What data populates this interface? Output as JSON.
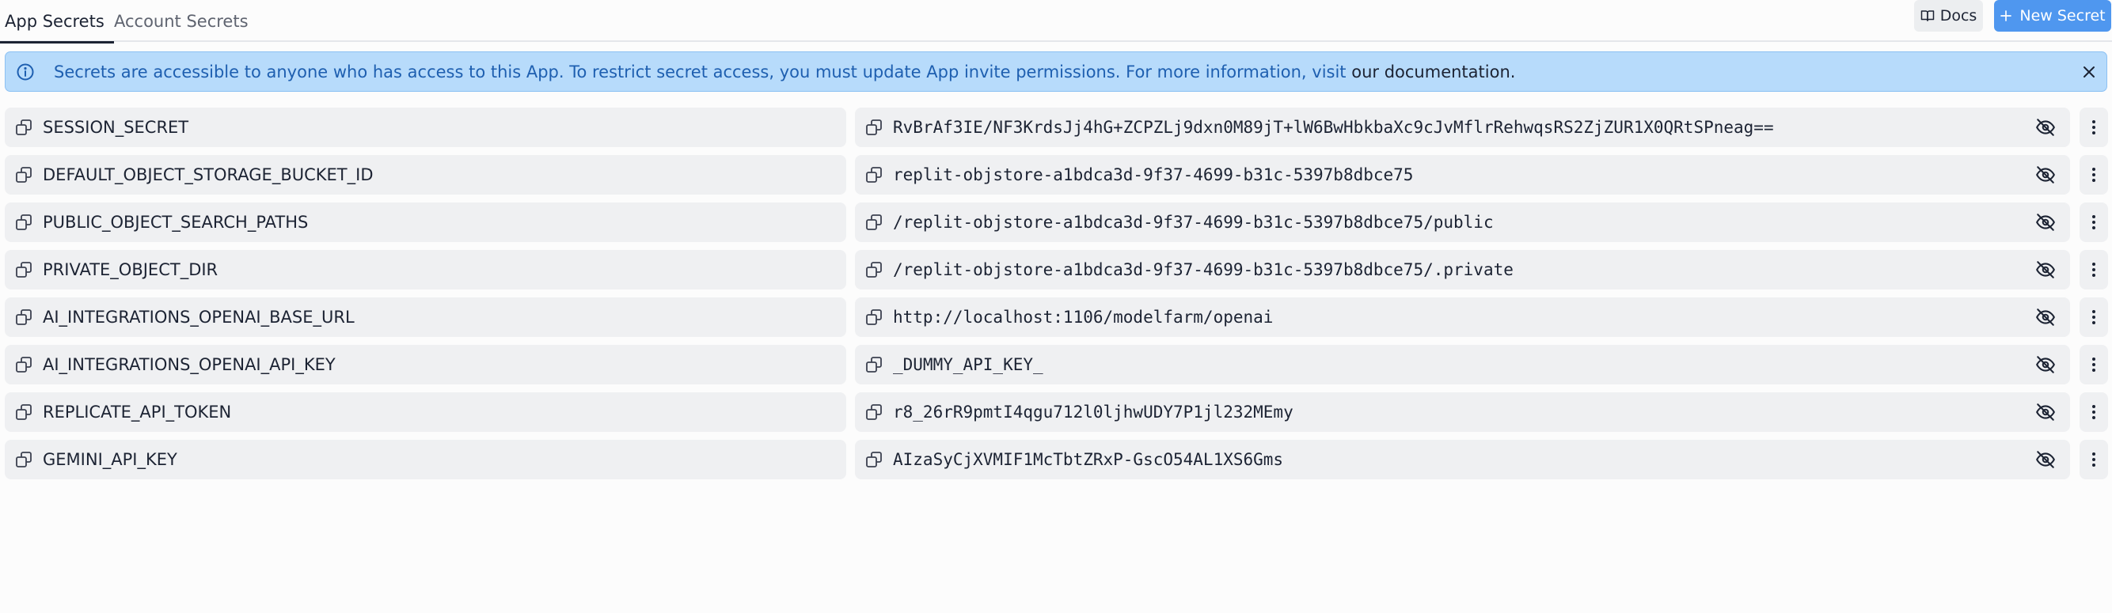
{
  "tabs": {
    "active": "App Secrets",
    "inactive": "Account Secrets"
  },
  "toolbar": {
    "docs_label": "Docs",
    "new_secret_label": "New Secret"
  },
  "banner": {
    "text": "Secrets are accessible to anyone who has access to this App. To restrict secret access, you must update App invite permissions. For more information, visit ",
    "link": "our documentation."
  },
  "secrets": [
    {
      "key": "SESSION_SECRET",
      "value": "RvBrAf3IE/NF3KrdsJj4hG+ZCPZLj9dxn0M89jT+lW6BwHbkbaXc9cJvMflrRehwqsRS2ZjZUR1X0QRtSPneag=="
    },
    {
      "key": "DEFAULT_OBJECT_STORAGE_BUCKET_ID",
      "value": "replit-objstore-a1bdca3d-9f37-4699-b31c-5397b8dbce75"
    },
    {
      "key": "PUBLIC_OBJECT_SEARCH_PATHS",
      "value": "/replit-objstore-a1bdca3d-9f37-4699-b31c-5397b8dbce75/public"
    },
    {
      "key": "PRIVATE_OBJECT_DIR",
      "value": "/replit-objstore-a1bdca3d-9f37-4699-b31c-5397b8dbce75/.private"
    },
    {
      "key": "AI_INTEGRATIONS_OPENAI_BASE_URL",
      "value": "http://localhost:1106/modelfarm/openai"
    },
    {
      "key": "AI_INTEGRATIONS_OPENAI_API_KEY",
      "value": "_DUMMY_API_KEY_"
    },
    {
      "key": "REPLICATE_API_TOKEN",
      "value": "r8_26rR9pmtI4qgu712l0ljhwUDY7P1jl232MEmy"
    },
    {
      "key": "GEMINI_API_KEY",
      "value": "AIzaSyCjXVMIF1McTbtZRxP-GscO54AL1XS6Gms"
    }
  ],
  "colors": {
    "accent": "#4f97ef",
    "banner_bg": "#b7dbfb",
    "banner_text": "#1e5fb0",
    "cell_bg": "#eff0f2"
  },
  "icons": {
    "docs": "book-icon",
    "new": "plus-icon",
    "info": "info-icon",
    "close": "close-icon",
    "copy": "copy-icon",
    "reveal": "eye-off-icon",
    "menu": "more-vertical-icon"
  }
}
